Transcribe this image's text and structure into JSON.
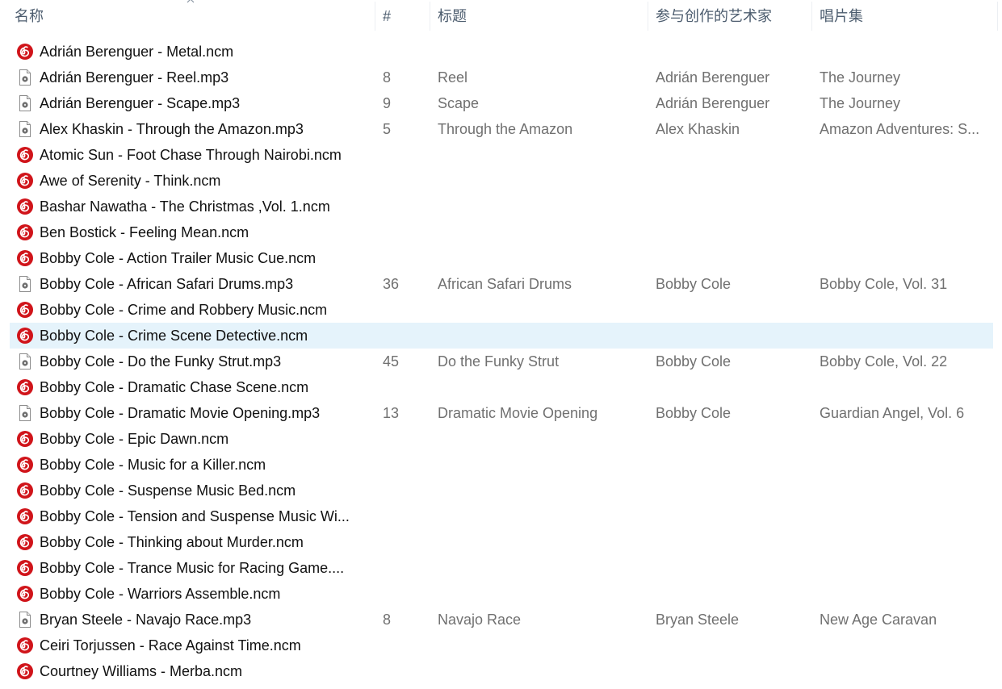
{
  "columns": {
    "name": "名称",
    "number": "#",
    "title": "标题",
    "artists": "参与创作的艺术家",
    "album": "唱片集"
  },
  "colors": {
    "ncm_icon": "#d0141a",
    "selected_row": "#e5f3fb",
    "header_text": "#4c5c6e",
    "meta_text": "#707070"
  },
  "rows": [
    {
      "icon": "netease-ncm-icon",
      "name": "Adrián Berenguer - Metal.ncm",
      "number": "",
      "title": "",
      "artist": "",
      "album": ""
    },
    {
      "icon": "mp3-file-icon",
      "name": "Adrián Berenguer - Reel.mp3",
      "number": "8",
      "title": "Reel",
      "artist": "Adrián Berenguer",
      "album": "The Journey"
    },
    {
      "icon": "mp3-file-icon",
      "name": "Adrián Berenguer - Scape.mp3",
      "number": "9",
      "title": "Scape",
      "artist": "Adrián Berenguer",
      "album": "The Journey"
    },
    {
      "icon": "mp3-file-icon",
      "name": "Alex Khaskin - Through the Amazon.mp3",
      "number": "5",
      "title": "Through the Amazon",
      "artist": "Alex Khaskin",
      "album": "Amazon Adventures: S..."
    },
    {
      "icon": "netease-ncm-icon",
      "name": "Atomic Sun - Foot Chase Through Nairobi.ncm",
      "number": "",
      "title": "",
      "artist": "",
      "album": ""
    },
    {
      "icon": "netease-ncm-icon",
      "name": "Awe of Serenity - Think.ncm",
      "number": "",
      "title": "",
      "artist": "",
      "album": ""
    },
    {
      "icon": "netease-ncm-icon",
      "name": "Bashar Nawatha - The Christmas ,Vol. 1.ncm",
      "number": "",
      "title": "",
      "artist": "",
      "album": ""
    },
    {
      "icon": "netease-ncm-icon",
      "name": "Ben Bostick - Feeling Mean.ncm",
      "number": "",
      "title": "",
      "artist": "",
      "album": ""
    },
    {
      "icon": "netease-ncm-icon",
      "name": "Bobby Cole - Action Trailer Music Cue.ncm",
      "number": "",
      "title": "",
      "artist": "",
      "album": ""
    },
    {
      "icon": "mp3-file-icon",
      "name": "Bobby Cole - African Safari Drums.mp3",
      "number": "36",
      "title": "African Safari Drums",
      "artist": "Bobby Cole",
      "album": "Bobby Cole, Vol. 31"
    },
    {
      "icon": "netease-ncm-icon",
      "name": "Bobby Cole - Crime and Robbery Music.ncm",
      "number": "",
      "title": "",
      "artist": "",
      "album": ""
    },
    {
      "icon": "netease-ncm-icon",
      "name": "Bobby Cole - Crime Scene Detective.ncm",
      "number": "",
      "title": "",
      "artist": "",
      "album": "",
      "selected": true
    },
    {
      "icon": "mp3-file-icon",
      "name": "Bobby Cole - Do the Funky Strut.mp3",
      "number": "45",
      "title": "Do the Funky Strut",
      "artist": "Bobby Cole",
      "album": "Bobby Cole, Vol. 22"
    },
    {
      "icon": "netease-ncm-icon",
      "name": "Bobby Cole - Dramatic Chase Scene.ncm",
      "number": "",
      "title": "",
      "artist": "",
      "album": ""
    },
    {
      "icon": "mp3-file-icon",
      "name": "Bobby Cole - Dramatic Movie Opening.mp3",
      "number": "13",
      "title": "Dramatic Movie Opening",
      "artist": "Bobby Cole",
      "album": "Guardian Angel, Vol. 6"
    },
    {
      "icon": "netease-ncm-icon",
      "name": "Bobby Cole - Epic Dawn.ncm",
      "number": "",
      "title": "",
      "artist": "",
      "album": ""
    },
    {
      "icon": "netease-ncm-icon",
      "name": "Bobby Cole - Music for a Killer.ncm",
      "number": "",
      "title": "",
      "artist": "",
      "album": ""
    },
    {
      "icon": "netease-ncm-icon",
      "name": "Bobby Cole - Suspense Music Bed.ncm",
      "number": "",
      "title": "",
      "artist": "",
      "album": ""
    },
    {
      "icon": "netease-ncm-icon",
      "name": "Bobby Cole - Tension and Suspense Music Wi...",
      "number": "",
      "title": "",
      "artist": "",
      "album": ""
    },
    {
      "icon": "netease-ncm-icon",
      "name": "Bobby Cole - Thinking about Murder.ncm",
      "number": "",
      "title": "",
      "artist": "",
      "album": ""
    },
    {
      "icon": "netease-ncm-icon",
      "name": "Bobby Cole - Trance Music for Racing Game....",
      "number": "",
      "title": "",
      "artist": "",
      "album": ""
    },
    {
      "icon": "netease-ncm-icon",
      "name": "Bobby Cole - Warriors Assemble.ncm",
      "number": "",
      "title": "",
      "artist": "",
      "album": ""
    },
    {
      "icon": "mp3-file-icon",
      "name": "Bryan Steele - Navajo Race.mp3",
      "number": "8",
      "title": "Navajo Race",
      "artist": "Bryan Steele",
      "album": "New Age Caravan"
    },
    {
      "icon": "netease-ncm-icon",
      "name": "Ceiri Torjussen - Race Against Time.ncm",
      "number": "",
      "title": "",
      "artist": "",
      "album": ""
    },
    {
      "icon": "netease-ncm-icon",
      "name": "Courtney Williams - Merba.ncm",
      "number": "",
      "title": "",
      "artist": "",
      "album": ""
    }
  ]
}
